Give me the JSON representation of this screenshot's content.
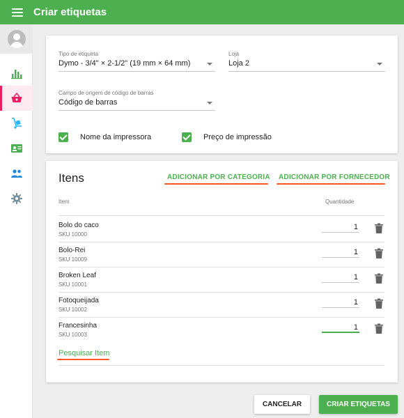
{
  "app": {
    "title": "Criar etiquetas"
  },
  "sidebar": {
    "items": [
      {
        "icon": "bar-chart-icon"
      },
      {
        "icon": "basket-icon",
        "active": true
      },
      {
        "icon": "hand-truck-icon"
      },
      {
        "icon": "id-card-icon"
      },
      {
        "icon": "people-icon"
      },
      {
        "icon": "gear-icon"
      }
    ]
  },
  "settings": {
    "label_type_label": "Tipo de etiqueta",
    "label_type_value": "Dymo - 3/4\" × 2-1/2\" (19 mm × 64 mm)",
    "store_label": "Loja",
    "store_value": "Loja 2",
    "barcode_source_label": "Campo de origem de código de barras",
    "barcode_source_value": "Código de barras",
    "printer_name_label": "Nome da impressora",
    "printer_name_checked": true,
    "print_price_label": "Preço de impressão",
    "print_price_checked": true
  },
  "items_section": {
    "title": "Itens",
    "add_by_category": "ADICIONAR POR CATEGORIA",
    "add_by_supplier": "ADICIONAR POR FORNECEDOR",
    "col_item": "Item",
    "col_quantity": "Quantidade",
    "rows": [
      {
        "name": "Bolo do caco",
        "sku": "SKU 10000",
        "qty": "1"
      },
      {
        "name": "Bolo-Rei",
        "sku": "SKU 10009",
        "qty": "1"
      },
      {
        "name": "Broken Leaf",
        "sku": "SKU 10001",
        "qty": "1"
      },
      {
        "name": "Fotoqueijada",
        "sku": "SKU 10002",
        "qty": "1"
      },
      {
        "name": "Francesinha",
        "sku": "SKU 10003",
        "qty": "1"
      }
    ],
    "search_item": "Pesquisar Item"
  },
  "footer": {
    "cancel": "CANCELAR",
    "create": "CRIAR ETIQUETAS"
  },
  "colors": {
    "primary": "#4caf50",
    "accent": "#e91e63",
    "highlight": "#ff5722"
  }
}
